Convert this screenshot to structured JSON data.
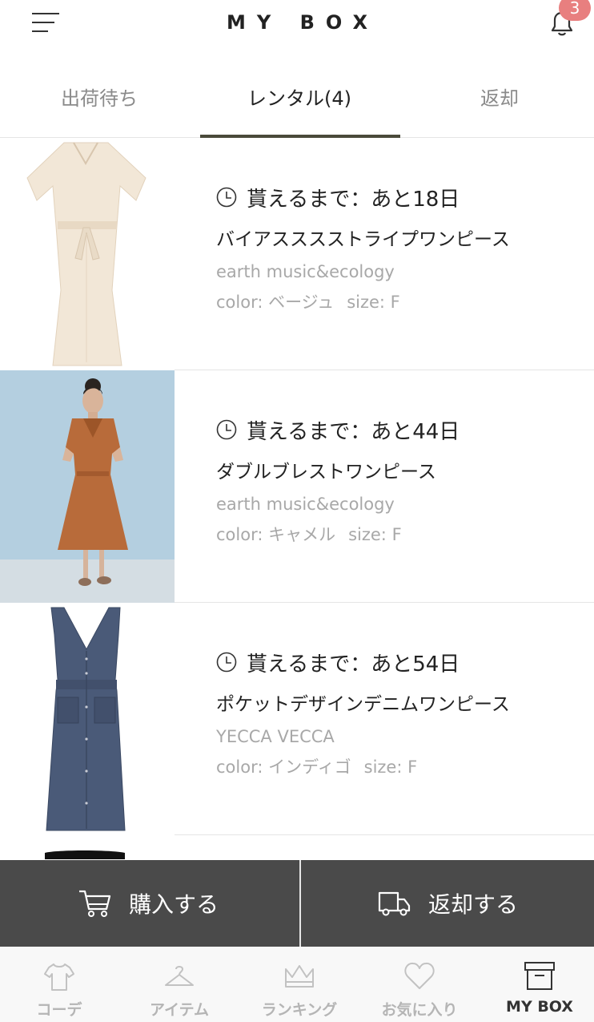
{
  "header": {
    "title": "MY BOX",
    "notification_count": "3",
    "badge_color": "#e87f7f"
  },
  "tabs": [
    {
      "label": "出荷待ち",
      "active": false
    },
    {
      "label": "レンタル(4)",
      "active": true
    },
    {
      "label": "返却",
      "active": false
    }
  ],
  "items": [
    {
      "deadline": "貰えるまで：あと18日",
      "name": "バイアスススストライプワンピース",
      "brand": "earth music&ecology",
      "color": "color: ベージュ",
      "size": "size: F",
      "image": "beige-dress"
    },
    {
      "deadline": "貰えるまで：あと44日",
      "name": "ダブルブレストワンピース",
      "brand": "earth music&ecology",
      "color": "color: キャメル",
      "size": "size: F",
      "image": "camel-dress-model"
    },
    {
      "deadline": "貰えるまで：あと54日",
      "name": "ポケットデザインデニムワンピース",
      "brand": "YECCA VECCA",
      "color": "color: インディゴ",
      "size": "size: F",
      "image": "denim-dress"
    }
  ],
  "actions": {
    "purchase_label": "購入する",
    "return_label": "返却する"
  },
  "bottom_nav": [
    {
      "label": "コーデ",
      "icon": "tshirt-icon",
      "active": false
    },
    {
      "label": "アイテム",
      "icon": "hanger-icon",
      "active": false
    },
    {
      "label": "ランキング",
      "icon": "crown-icon",
      "active": false
    },
    {
      "label": "お気に入り",
      "icon": "heart-icon",
      "active": false
    },
    {
      "label": "MY BOX",
      "icon": "box-icon",
      "active": true
    }
  ],
  "colors": {
    "action_bar": "#4a4a4a",
    "tab_indicator": "#4a4a3a",
    "muted_text": "#a8a8a8"
  }
}
